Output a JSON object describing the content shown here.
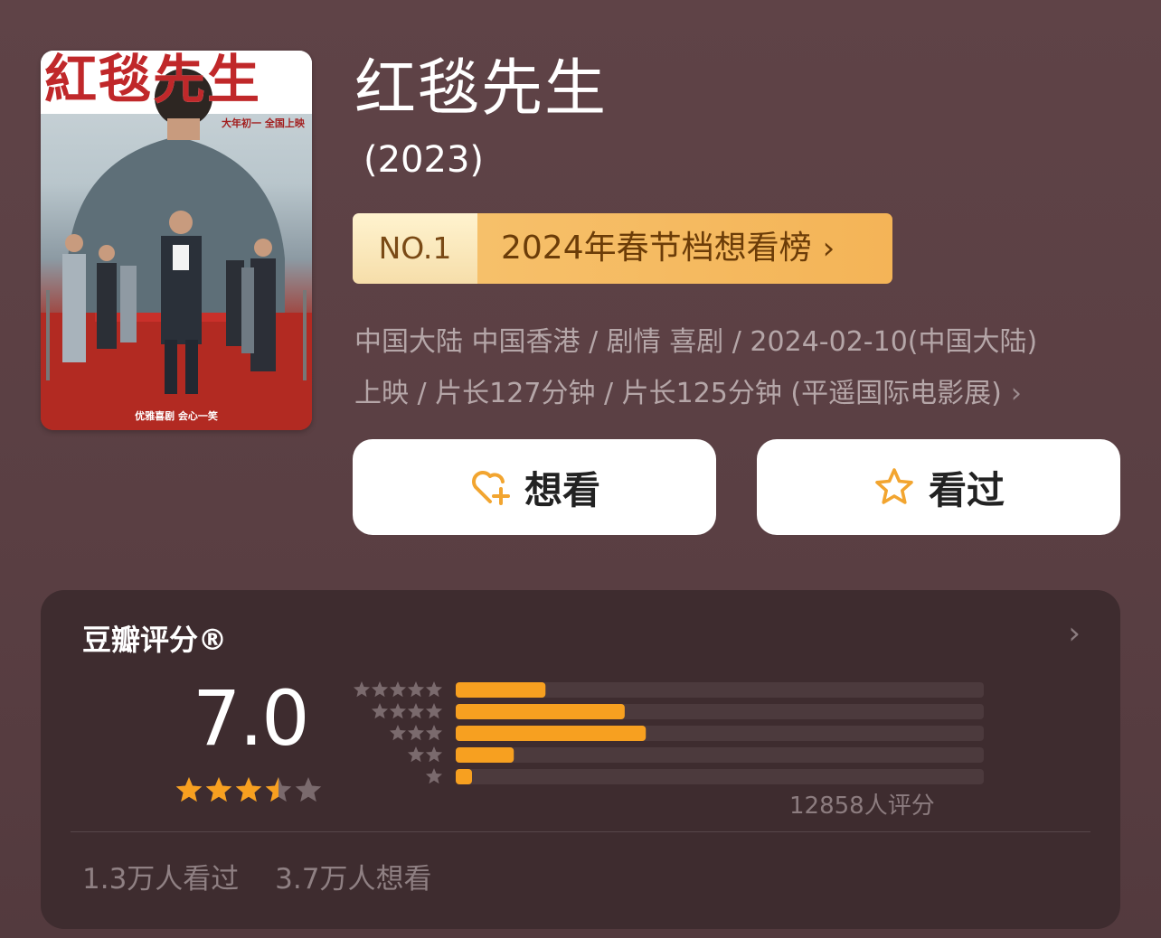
{
  "movie": {
    "title": "红毯先生",
    "year": "(2023)",
    "poster": {
      "title_text": "紅毯先生",
      "tagline": "大年初一 全国上映",
      "footer_text": "优雅喜剧 会心一笑"
    }
  },
  "ranking": {
    "no": "NO.1",
    "list": "2024年春节档想看榜",
    "chevron": "›"
  },
  "meta": {
    "line1": "中国大陆 中国香港 / 剧情 喜剧 / 2024-02-10(中国大陆)",
    "line2": "上映 / 片长127分钟 / 片长125分钟 (平遥国际电影展)",
    "chevron": "›"
  },
  "actions": {
    "want_label": "想看",
    "want_icon": "heart-plus-icon",
    "seen_label": "看过",
    "seen_icon": "star-outline-icon",
    "accent": "#f2a530"
  },
  "rating": {
    "title": "豆瓣评分®",
    "chevron": "›",
    "score": "7.0",
    "stars_value": 3.5,
    "stars_max": 5,
    "distribution": [
      {
        "stars": 5,
        "fraction": 0.17
      },
      {
        "stars": 4,
        "fraction": 0.32
      },
      {
        "stars": 3,
        "fraction": 0.36
      },
      {
        "stars": 2,
        "fraction": 0.11
      },
      {
        "stars": 1,
        "fraction": 0.03
      }
    ],
    "count_text": "12858人评分",
    "footer": {
      "seen": "1.3万人看过",
      "want": "3.7万人想看"
    },
    "colors": {
      "bar_fill": "#f7a020",
      "bar_track": "#4c3a3d",
      "star_active": "#f7a020",
      "star_inactive": "#7a6a6d"
    }
  }
}
